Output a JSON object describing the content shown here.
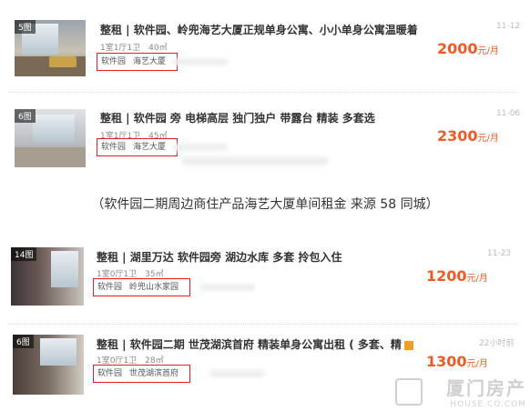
{
  "listings": [
    {
      "photo_count": "5图",
      "title": "整租 | 软件园、岭兜海艺大厦正规单身公寓、小小单身公寓温暖着",
      "meta": "1室1厅1卫　40㎡",
      "tags": [
        "软件园",
        "海艺大厦"
      ],
      "date": "11-12",
      "price": "2000",
      "unit": "元/月"
    },
    {
      "photo_count": "6图",
      "title": "整租 | 软件园 旁 电梯高层 独门独户 带露台 精装 多套选",
      "meta": "1室1厅1卫　45㎡",
      "tags": [
        "软件园",
        "海艺大厦"
      ],
      "date": "11-06",
      "price": "2300",
      "unit": "元/月"
    },
    {
      "photo_count": "14图",
      "title": "整租 | 湖里万达 软件园旁 湖边水库 多套 拎包入住",
      "meta": "1室0厅1卫　35㎡",
      "tags": [
        "软件园",
        "岭兜山水家园"
      ],
      "date": "11-23",
      "price": "1200",
      "unit": "元/月"
    },
    {
      "photo_count": "6图",
      "title": "整租 | 软件园二期 世茂湖滨首府 精装单身公寓出租 ( 多套、精",
      "meta": "1室0厅1卫　28㎡",
      "tags": [
        "软件园",
        "世茂湖滨首府"
      ],
      "date": "22小时前",
      "price": "1300",
      "unit": "元/月"
    }
  ],
  "caption": "（软件园二期周边商住产品海艺大厦单间租金  来源 58 同城）",
  "watermark": {
    "text": "厦门房产",
    "domain": "HOUSE.CO.COM"
  },
  "colors": {
    "price": "#f05a24",
    "tag_border": "#e02020"
  }
}
